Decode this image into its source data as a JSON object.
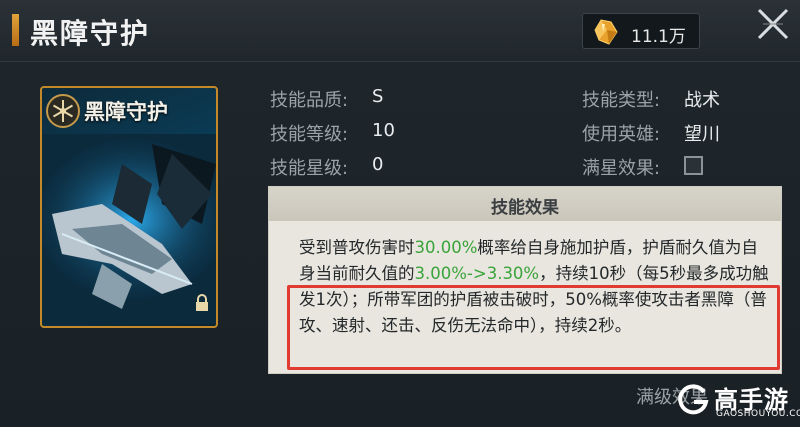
{
  "header": {
    "title": "黑障守护",
    "currency_icon": "gold-crystal-icon",
    "currency_value": "11.1万",
    "close_icon": "close-x-icon"
  },
  "card": {
    "title": "黑障守护",
    "emblem_icon": "snowflake-emblem-icon",
    "lock_icon": "lock-icon"
  },
  "info": {
    "quality_label": "技能品质:",
    "quality_value": "S",
    "level_label": "技能等级:",
    "level_value": "10",
    "star_label": "技能星级:",
    "star_value": "0",
    "type_label": "技能类型:",
    "type_value": "战术",
    "hero_label": "使用英雄:",
    "hero_value": "望川",
    "maxstar_label": "满星效果:",
    "maxstar_checked": false
  },
  "effect": {
    "title": "技能效果",
    "seg1": "受到普攻伤害时",
    "seg2": "30.00%",
    "seg3": "概率给自身施加护盾，护盾耐久值为自身当前耐久值的",
    "seg4": "3.00%->3.30%",
    "seg5": "，持续10秒（每5秒最多成功触发1次）；所带军团的护盾被击破时，50%概率使攻击者黑障（普攻、速射、还击、反伤无法命中），持续2秒。",
    "highlight_color": "#3aa43a"
  },
  "footer": {
    "max_star_text": "满级效果"
  },
  "watermark": {
    "logo": "高手游",
    "sub": "GAOSHOUYOU.COM"
  }
}
